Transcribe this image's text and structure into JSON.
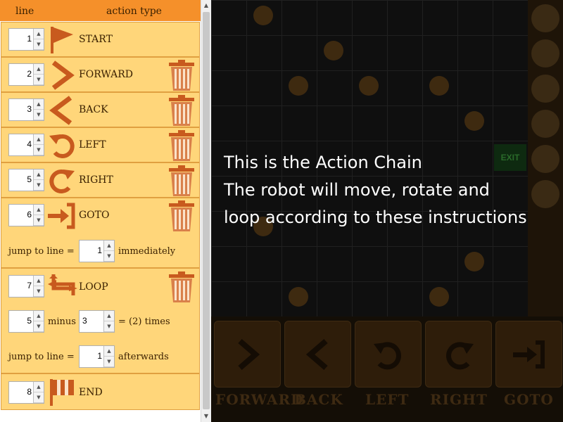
{
  "header": {
    "line_label": "line",
    "type_label": "action type"
  },
  "rows": [
    {
      "line": "1",
      "action": "START"
    },
    {
      "line": "2",
      "action": "FORWARD"
    },
    {
      "line": "3",
      "action": "BACK"
    },
    {
      "line": "4",
      "action": "LEFT"
    },
    {
      "line": "5",
      "action": "RIGHT"
    },
    {
      "line": "6",
      "action": "GOTO"
    },
    {
      "line": "7",
      "action": "LOOP"
    },
    {
      "line": "8",
      "action": "END"
    }
  ],
  "goto": {
    "jump_label": "jump to line =",
    "jump_value": "1",
    "when": "immediately"
  },
  "loop": {
    "left_value": "5",
    "minus_label": "minus",
    "right_value": "3",
    "times_label": "= (2) times",
    "jump_label": "jump to line =",
    "jump_value": "1",
    "when": "afterwards"
  },
  "overlay": {
    "line1": "This is the Action Chain",
    "line2": "The robot will move, rotate and",
    "line3": "loop according to these instructions"
  },
  "palette": [
    "FORWARD",
    "BACK",
    "LEFT",
    "RIGHT",
    "GOTO"
  ],
  "exit_sign": "EXIT",
  "colors": {
    "header": "#f5902a",
    "row": "#ffd67a",
    "icon": "#c85a1e",
    "text": "#3a2000"
  }
}
